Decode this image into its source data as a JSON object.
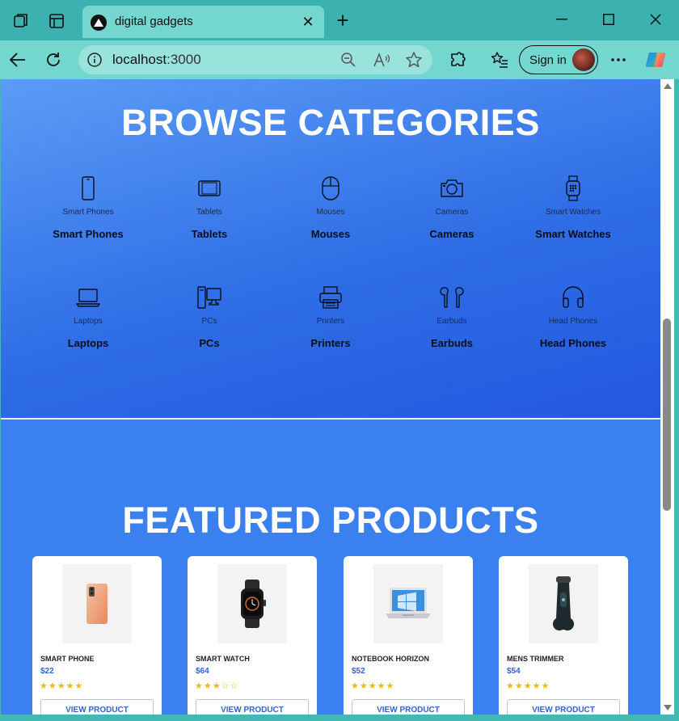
{
  "browser": {
    "tab_title": "digital gadgets",
    "address_host": "localhost",
    "address_port": ":3000",
    "signin_label": "Sign in"
  },
  "categories_section": {
    "heading": "BROWSE CATEGORIES",
    "items": [
      {
        "icon": "smartphone-icon",
        "small": "Smart Phones",
        "label": "Smart Phones"
      },
      {
        "icon": "tablet-icon",
        "small": "Tablets",
        "label": "Tablets"
      },
      {
        "icon": "mouse-icon",
        "small": "Mouses",
        "label": "Mouses"
      },
      {
        "icon": "camera-icon",
        "small": "Cameras",
        "label": "Cameras"
      },
      {
        "icon": "smartwatch-icon",
        "small": "Smart Watches",
        "label": "Smart Watches"
      },
      {
        "icon": "laptop-icon",
        "small": "Laptops",
        "label": "Laptops"
      },
      {
        "icon": "desktop-pc-icon",
        "small": "PCs",
        "label": "PCs"
      },
      {
        "icon": "printer-icon",
        "small": "Printers",
        "label": "Printers"
      },
      {
        "icon": "earbuds-icon",
        "small": "Earbuds",
        "label": "Earbuds"
      },
      {
        "icon": "headphones-icon",
        "small": "Head Phones",
        "label": "Head Phones"
      }
    ]
  },
  "featured_section": {
    "heading": "FEATURED PRODUCTS",
    "products": [
      {
        "name": "SMART PHONE",
        "price": "$22",
        "stars": "★★★★★",
        "button": "VIEW PRODUCT",
        "image": "phone-image"
      },
      {
        "name": "SMART WATCH",
        "price": "$64",
        "stars": "★★★☆☆",
        "button": "VIEW PRODUCT",
        "image": "watch-image"
      },
      {
        "name": "NOTEBOOK HORIZON",
        "price": "$52",
        "stars": "★★★★★",
        "button": "VIEW PRODUCT",
        "image": "laptop-image"
      },
      {
        "name": "MENS TRIMMER",
        "price": "$54",
        "stars": "★★★★★",
        "button": "VIEW PRODUCT",
        "image": "trimmer-image"
      }
    ]
  },
  "colors": {
    "accent": "#3b80ef",
    "price": "#2f63d8",
    "star": "#f3b80c",
    "browser_frame": "#43b9b6"
  }
}
